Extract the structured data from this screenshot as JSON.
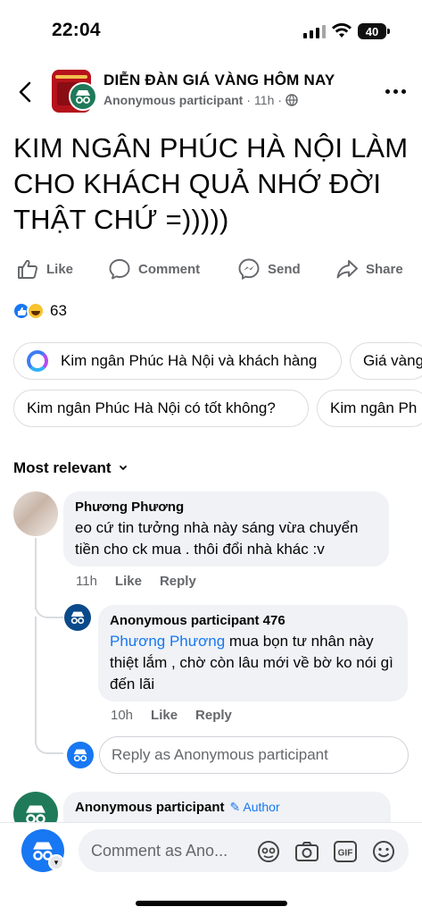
{
  "status": {
    "time": "22:04",
    "battery": "40"
  },
  "header": {
    "group_name": "DIỄN ĐÀN GIÁ VÀNG HÔM NAY",
    "author": "Anonymous participant",
    "time": "11h"
  },
  "post": {
    "title": "KIM NGÂN PHÚC HÀ NỘI LÀM CHO KHÁCH QUẢ NHỚ ĐỜI THẬT CHỨ =)))))"
  },
  "actions": {
    "like": "Like",
    "comment": "Comment",
    "send": "Send",
    "share": "Share"
  },
  "reactions": {
    "count": "63"
  },
  "suggestions": {
    "row1": [
      "Kim ngân Phúc Hà Nội và khách hàng",
      "Giá vàng"
    ],
    "row2": [
      "Kim ngân Phúc Hà Nội có tốt không?",
      "Kim ngân Ph"
    ]
  },
  "sort": {
    "label": "Most relevant"
  },
  "comments": [
    {
      "name": "Phương Phương",
      "text": "eo cứ tin tưởng nhà này sáng vừa chuyển tiền cho ck mua . thôi đổi nhà khác :v",
      "time": "11h",
      "like": "Like",
      "reply": "Reply"
    },
    {
      "name": "Anonymous participant 476",
      "mention": "Phương Phương",
      "text": " mua bọn tư nhân này thiệt lắm , chờ còn lâu mới về bờ ko nói gì đến lãi",
      "time": "10h",
      "like": "Like",
      "reply": "Reply"
    },
    {
      "name": "Anonymous participant",
      "author_tag": "Author"
    }
  ],
  "reply_placeholder": "Reply as Anonymous participant",
  "composer": {
    "placeholder": "Comment as Ano..."
  },
  "colors": {
    "accent": "#1877f2",
    "muted": "#65676b",
    "bubble": "#f0f2f5"
  }
}
